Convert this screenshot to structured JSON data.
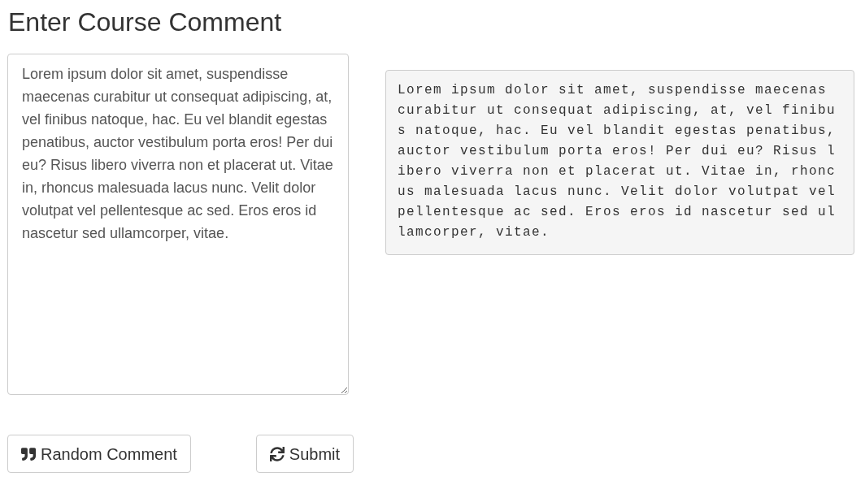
{
  "title": "Enter Course Comment",
  "comment_field": {
    "value": "Lorem ipsum dolor sit amet, suspendisse maecenas curabitur ut consequat adipiscing, at, vel finibus natoque, hac. Eu vel blandit egestas penatibus, auctor vestibulum porta eros! Per dui eu? Risus libero viverra non et placerat ut. Vitae in, rhoncus malesuada lacus nunc. Velit dolor volutpat vel pellentesque ac sed. Eros eros id nascetur sed ullamcorper, vitae."
  },
  "preview": "Lorem ipsum dolor sit amet, suspendisse maecenas curabitur ut consequat adipiscing, at, vel finibus natoque, hac. Eu vel blandit egestas penatibus, auctor vestibulum porta eros! Per dui eu? Risus libero viverra non et placerat ut. Vitae in, rhoncus malesuada lacus nunc. Velit dolor volutpat vel pellentesque ac sed. Eros eros id nascetur sed ullamcorper, vitae.",
  "buttons": [
    {
      "label": "Random Comment",
      "kind": "quote"
    },
    {
      "label": "Submit",
      "kind": "refresh"
    }
  ]
}
